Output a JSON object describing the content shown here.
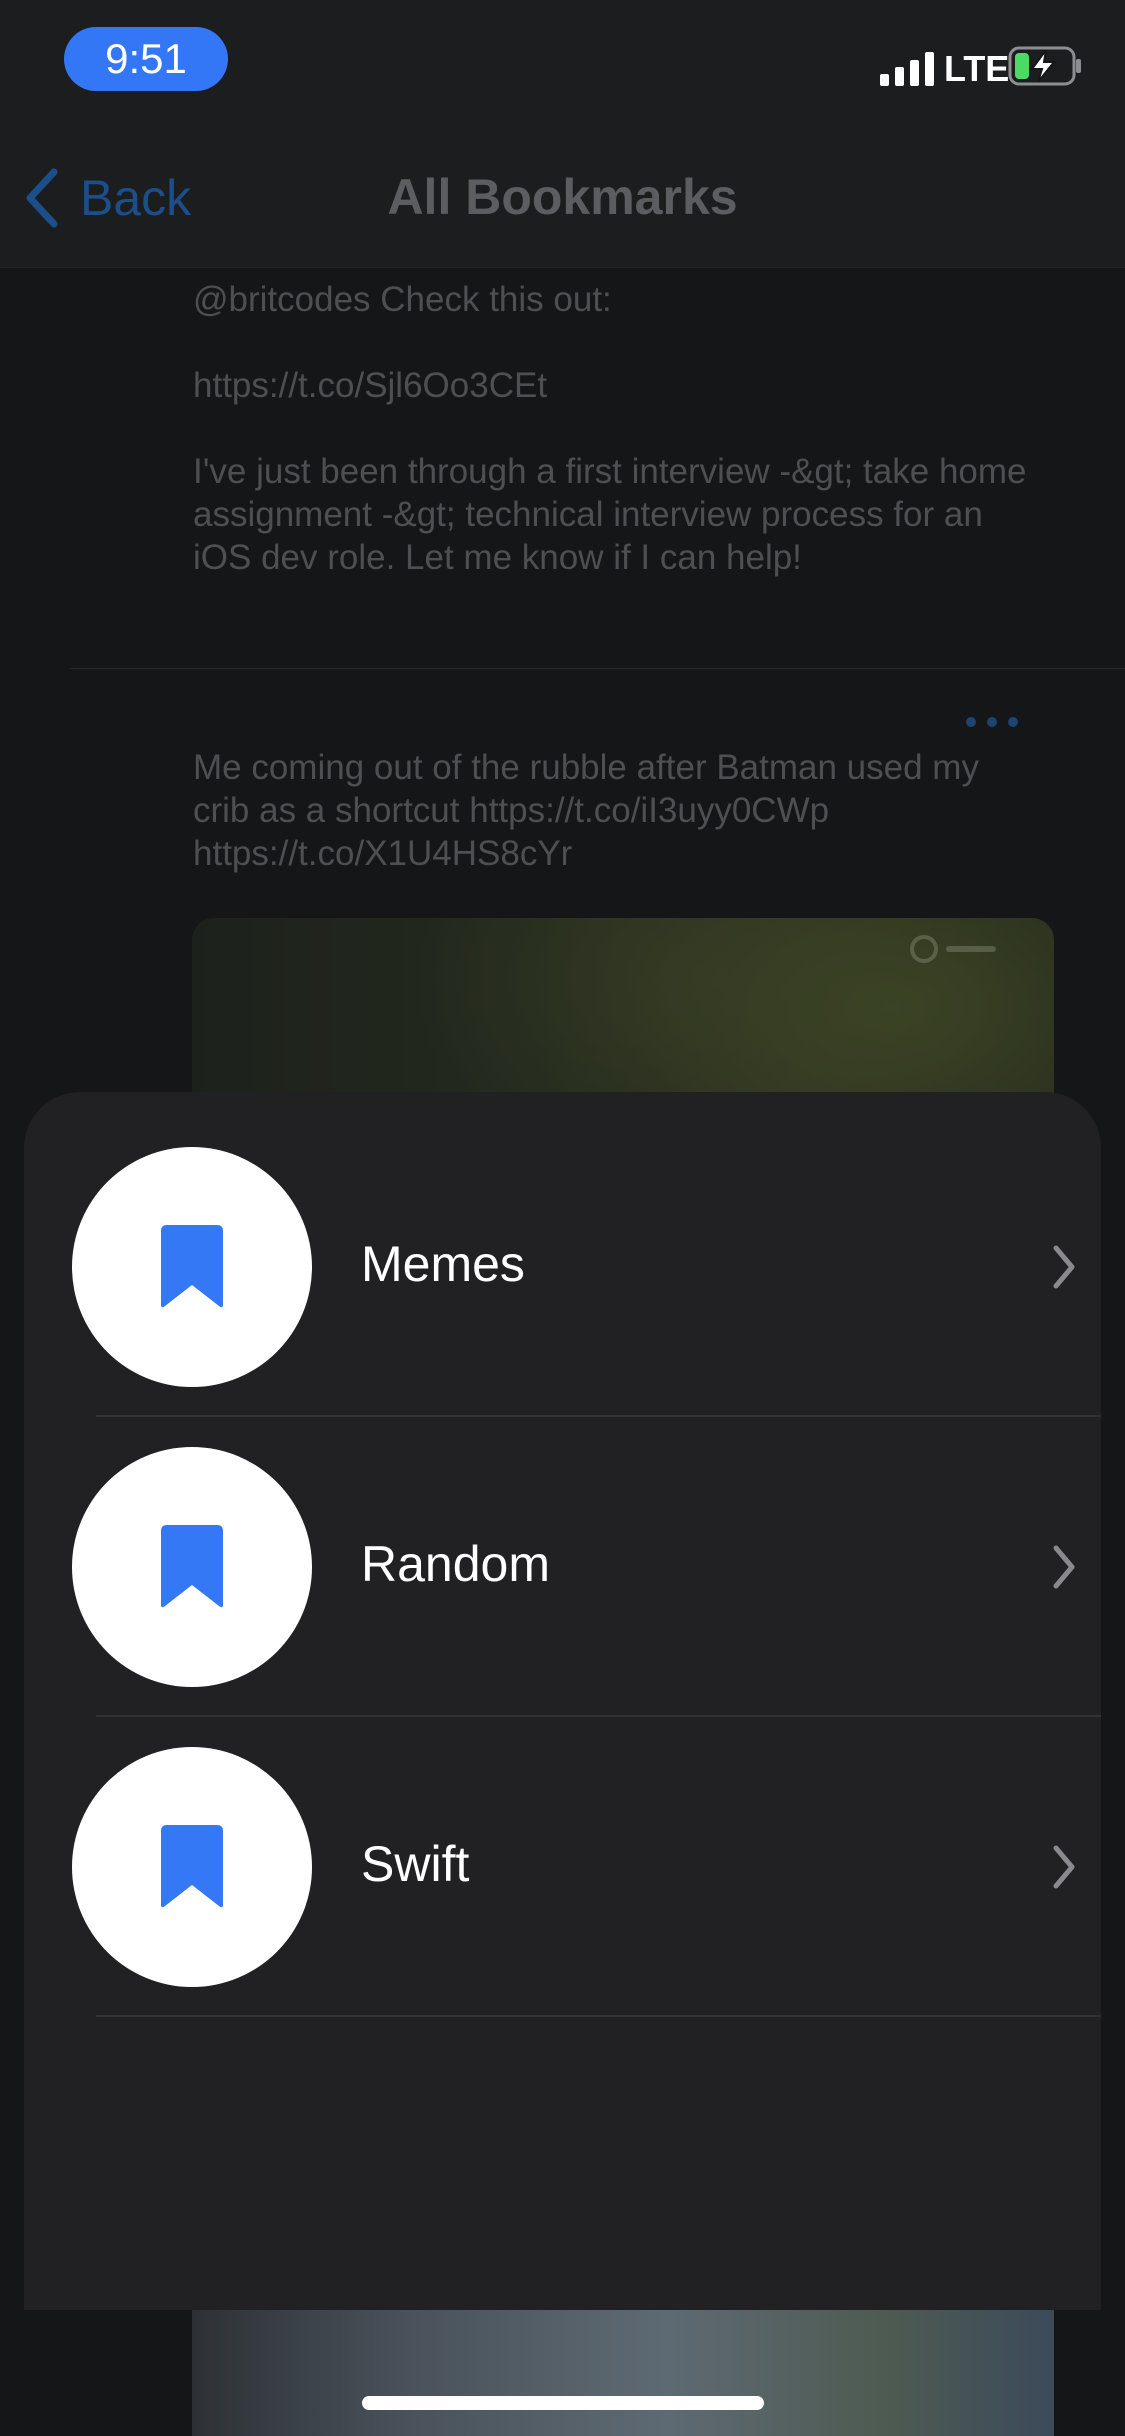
{
  "status_bar": {
    "time": "9:51",
    "network": "LTE"
  },
  "navbar": {
    "back_label": "Back",
    "title": "All Bookmarks"
  },
  "tweets": [
    {
      "text": "@britcodes Check this out:\n\nhttps://t.co/Sjl6Oo3CEt\n\nI've just been through a first interview -&gt; take home assignment -&gt; technical interview process for an iOS dev role. Let me know if I can help!"
    },
    {
      "text": "Me coming out of the rubble after Batman used my crib as a shortcut https://t.co/iI3uyy0CWp https://t.co/X1U4HS8cYr"
    }
  ],
  "bookmark_sheet": {
    "folders": [
      {
        "label": "Memes",
        "icon": "bookmark-icon"
      },
      {
        "label": "Random",
        "icon": "bookmark-icon"
      },
      {
        "label": "Swift",
        "icon": "bookmark-icon"
      }
    ]
  },
  "colors": {
    "accent": "#3478F6",
    "sheet_bg": "#212123",
    "icon_circle": "#FFFFFF"
  }
}
